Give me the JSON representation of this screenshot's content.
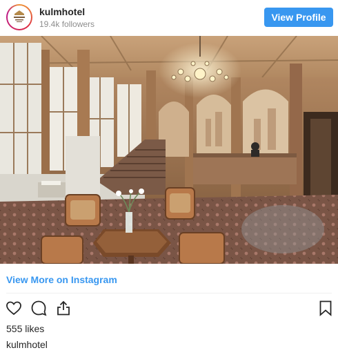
{
  "header": {
    "username": "kulmhotel",
    "followers": "19.4k followers",
    "view_profile_label": "View Profile"
  },
  "avatar": {
    "logo_text": "KULM HOTEL ST. MORITZ"
  },
  "post": {
    "view_more_label": "View More on Instagram",
    "likes": "555 likes",
    "caption_username": "kulmhotel"
  },
  "icons": {
    "like": "heart-icon",
    "comment": "comment-bubble-icon",
    "share": "share-icon",
    "save": "bookmark-icon"
  },
  "colors": {
    "accent": "#3897f0",
    "text": "#262626",
    "muted": "#8e8e8e"
  }
}
